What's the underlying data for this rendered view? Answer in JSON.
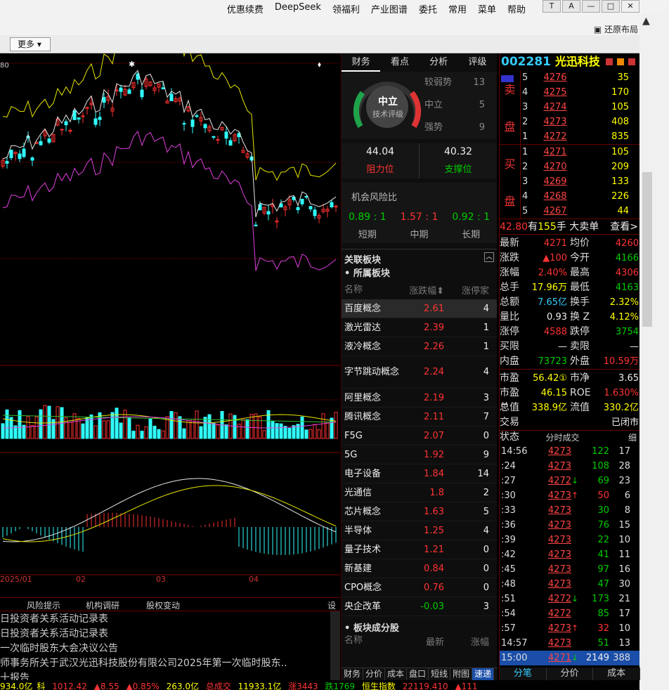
{
  "menu": [
    "优惠续费",
    "DeepSeek",
    "领福利",
    "产业图谱",
    "委托",
    "常用",
    "菜单",
    "帮助"
  ],
  "window_buttons": [
    "T",
    "A",
    "—",
    "□",
    "✕"
  ],
  "restore_layout": "还原布局",
  "more_button": "更多",
  "chart": {
    "price_label": "80",
    "dates": [
      "2025/01",
      "02",
      "03",
      "04"
    ],
    "colors": {
      "up": "#ff3030",
      "down": "#30ffff",
      "ma_upper": "#e6e600",
      "ma_mid": "#e6e6e6",
      "ma_lower": "#e040e0",
      "vol_ma1": "#e6e600",
      "vol_ma2": "#30c030",
      "vol_ma3": "#e040e0"
    }
  },
  "news_tabs": [
    "风险提示",
    "机构调研",
    "股权变动",
    "设"
  ],
  "news": [
    "日投资者关系活动记录表",
    "日投资者关系活动记录表",
    "一次临时股东大会决议公告",
    "师事务所关于武汉光迅科技股份有限公司2025年第一次临时股东..",
    "十报告"
  ],
  "status_bar": {
    "s1": "934.0亿",
    "s2": "科",
    "s3": "1012.42",
    "s4": "▲8.55",
    "s5": "▲0.85%",
    "s6": "263.0亿",
    "s7": "总成交",
    "s8": "11933.1亿",
    "s9": "涨3443",
    "s10": "跌1769",
    "s11": "恒生指数",
    "s12": "22119.410",
    "s13": "▲111"
  },
  "mid": {
    "tabs": [
      "财务",
      "看点",
      "分析",
      "评级"
    ],
    "gauge": {
      "center": "中立",
      "sub": "技术评级"
    },
    "ratings": [
      {
        "label": "较弱势",
        "value": "13"
      },
      {
        "label": "中立",
        "value": "5"
      },
      {
        "label": "强势",
        "value": "9"
      }
    ],
    "resistance": {
      "value": "44.04",
      "label": "阻力位"
    },
    "support": {
      "value": "40.32",
      "label": "支撑位"
    },
    "risk_title": "机会风险比",
    "risk": [
      {
        "value": "0.89 : 1",
        "label": "短期"
      },
      {
        "value": "1.57 : 1",
        "label": "中期"
      },
      {
        "value": "0.92 : 1",
        "label": "长期"
      }
    ],
    "blocks_head": "关联板块",
    "blocks_sub": "• 所属板块",
    "col_name": "名称",
    "col_pct": "涨跌幅",
    "col_cnt": "涨停家",
    "blocks": [
      {
        "name": "百度概念",
        "pct": "2.61",
        "cnt": "4"
      },
      {
        "name": "激光雷达",
        "pct": "2.39",
        "cnt": "1"
      },
      {
        "name": "液冷概念",
        "pct": "2.26",
        "cnt": "1"
      },
      {
        "name": "字节跳动概念",
        "pct": "2.24",
        "cnt": "4"
      },
      {
        "name": "阿里概念",
        "pct": "2.19",
        "cnt": "3"
      },
      {
        "name": "腾讯概念",
        "pct": "2.11",
        "cnt": "7"
      },
      {
        "name": "F5G",
        "pct": "2.07",
        "cnt": "0"
      },
      {
        "name": "5G",
        "pct": "1.92",
        "cnt": "9"
      },
      {
        "name": "电子设备",
        "pct": "1.84",
        "cnt": "14"
      },
      {
        "name": "光通信",
        "pct": "1.8",
        "cnt": "2"
      },
      {
        "name": "芯片概念",
        "pct": "1.63",
        "cnt": "5"
      },
      {
        "name": "半导体",
        "pct": "1.25",
        "cnt": "4"
      },
      {
        "name": "量子技术",
        "pct": "1.21",
        "cnt": "0"
      },
      {
        "name": "新基建",
        "pct": "0.84",
        "cnt": "0"
      },
      {
        "name": "CPO概念",
        "pct": "0.76",
        "cnt": "0"
      },
      {
        "name": "央企改革",
        "pct": "-0.03",
        "cnt": "3"
      }
    ],
    "blocks_sub2": "• 板块成分股",
    "col2_name": "名称",
    "col2_latest": "最新",
    "col2_pct": "涨幅",
    "foot": [
      "财务",
      "分价",
      "成本",
      "盘口",
      "短线",
      "附图",
      "速递"
    ]
  },
  "right": {
    "code": "002281",
    "name": "光迅科技",
    "sell_label": [
      "卖",
      "盘"
    ],
    "buy_label": [
      "买",
      "盘"
    ],
    "sell": [
      {
        "i": "5",
        "p": "4276",
        "v": "35"
      },
      {
        "i": "4",
        "p": "4275",
        "v": "170"
      },
      {
        "i": "3",
        "p": "4274",
        "v": "105"
      },
      {
        "i": "2",
        "p": "4273",
        "v": "408"
      },
      {
        "i": "1",
        "p": "4272",
        "v": "835"
      }
    ],
    "buy": [
      {
        "i": "1",
        "p": "4271",
        "v": "105"
      },
      {
        "i": "2",
        "p": "4270",
        "v": "209"
      },
      {
        "i": "3",
        "p": "4269",
        "v": "133"
      },
      {
        "i": "4",
        "p": "4268",
        "v": "226"
      },
      {
        "i": "5",
        "p": "4267",
        "v": "44"
      }
    ],
    "big_order": {
      "price": "42.80",
      "text1": "有",
      "num": "155",
      "text2": "手 大卖单",
      "link": "查看>"
    },
    "quotes": [
      {
        "k": "最新",
        "v1": "4271",
        "k2": "均价",
        "v2": "4260",
        "c1": "red",
        "c2": "red"
      },
      {
        "k": "涨跌",
        "v1": "▲100",
        "k2": "今开",
        "v2": "4166",
        "c1": "red",
        "c2": "green"
      },
      {
        "k": "涨幅",
        "v1": "2.40%",
        "k2": "最高",
        "v2": "4306",
        "c1": "red",
        "c2": "red"
      },
      {
        "k": "总手",
        "v1": "17.96万",
        "k2": "最低",
        "v2": "4163",
        "c1": "yellow",
        "c2": "green"
      },
      {
        "k": "总额",
        "v1": "7.65亿",
        "k2": "换手",
        "v2": "2.32%",
        "c1": "cyan",
        "c2": "yellow"
      },
      {
        "k": "量比",
        "v1": "0.93",
        "k2": "换 Z",
        "v2": "4.12%",
        "c1": "white",
        "c2": "yellow"
      },
      {
        "k": "涨停",
        "v1": "4588",
        "k2": "跌停",
        "v2": "3754",
        "c1": "red",
        "c2": "green"
      },
      {
        "k": "买限",
        "v1": "—",
        "k2": "卖限",
        "v2": "—",
        "c1": "white",
        "c2": "white"
      },
      {
        "k": "内盘",
        "v1": "73723",
        "k2": "外盘",
        "v2": "10.59万",
        "c1": "green",
        "c2": "red"
      }
    ],
    "quotes2": [
      {
        "k": "市盈",
        "v1": "56.42①",
        "k2": "市净",
        "v2": "3.65",
        "c1": "yellow",
        "c2": "white"
      },
      {
        "k": "市盈™",
        "v1": "46.15",
        "k2": "ROE",
        "v2": "1.630%",
        "c1": "yellow",
        "c2": "red"
      },
      {
        "k": "总值",
        "v1": "338.9亿",
        "k2": "流值",
        "v2": "330.2亿",
        "c1": "yellow",
        "c2": "yellow"
      },
      {
        "k": "交易状态",
        "v1": "",
        "k2": "",
        "v2": "已闭市",
        "c1": "white",
        "c2": "white"
      }
    ],
    "ticks_title": "分时成交",
    "ticks_tab": "细",
    "ticks": [
      {
        "t": "14:56",
        "p": "4273",
        "a": "",
        "v": "122",
        "n": "17",
        "vc": "green"
      },
      {
        "t": ":24",
        "p": "4273",
        "a": "",
        "v": "108",
        "n": "28",
        "vc": "green"
      },
      {
        "t": ":27",
        "p": "4272",
        "a": "↓",
        "v": "69",
        "n": "23",
        "vc": "green"
      },
      {
        "t": ":30",
        "p": "4273",
        "a": "↑",
        "v": "50",
        "n": "6",
        "vc": "red"
      },
      {
        "t": ":33",
        "p": "4273",
        "a": "",
        "v": "30",
        "n": "8",
        "vc": "green"
      },
      {
        "t": ":36",
        "p": "4273",
        "a": "",
        "v": "76",
        "n": "15",
        "vc": "green"
      },
      {
        "t": ":39",
        "p": "4273",
        "a": "",
        "v": "22",
        "n": "10",
        "vc": "green"
      },
      {
        "t": ":42",
        "p": "4273",
        "a": "",
        "v": "41",
        "n": "11",
        "vc": "green"
      },
      {
        "t": ":45",
        "p": "4273",
        "a": "",
        "v": "97",
        "n": "16",
        "vc": "green"
      },
      {
        "t": ":48",
        "p": "4273",
        "a": "",
        "v": "47",
        "n": "30",
        "vc": "green"
      },
      {
        "t": ":51",
        "p": "4272",
        "a": "↓",
        "v": "173",
        "n": "21",
        "vc": "green"
      },
      {
        "t": ":54",
        "p": "4272",
        "a": "",
        "v": "85",
        "n": "17",
        "vc": "green"
      },
      {
        "t": ":57",
        "p": "4273",
        "a": "↑",
        "v": "32",
        "n": "10",
        "vc": "red"
      },
      {
        "t": "14:57",
        "p": "4273",
        "a": "",
        "v": "51",
        "n": "13",
        "vc": "green"
      },
      {
        "t": "15:00",
        "p": "4271",
        "a": "↓",
        "v": "2149",
        "n": "388",
        "vc": "white"
      }
    ],
    "foot": [
      "分笔",
      "分价",
      "成本"
    ]
  }
}
